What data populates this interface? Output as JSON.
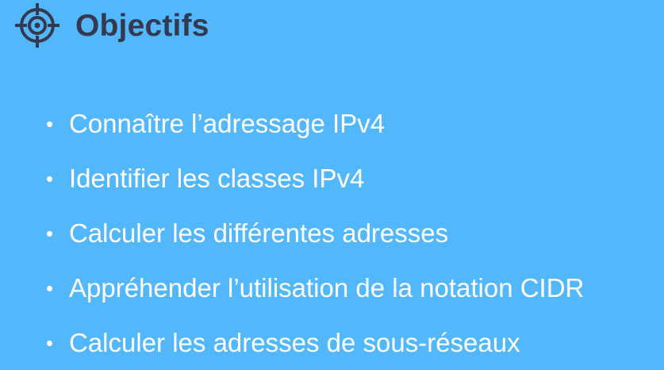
{
  "slide": {
    "title": "Objectifs",
    "title_icon": "target-icon",
    "title_color": "#34394f",
    "background_color": "#53b8fb",
    "bullet_symbol": "•",
    "bullets": [
      "Connaître l’adressage IPv4",
      "Identifier les classes IPv4",
      "Calculer les différentes adresses",
      "Appréhender l’utilisation de la notation CIDR",
      "Calculer les adresses de sous-réseaux"
    ]
  }
}
